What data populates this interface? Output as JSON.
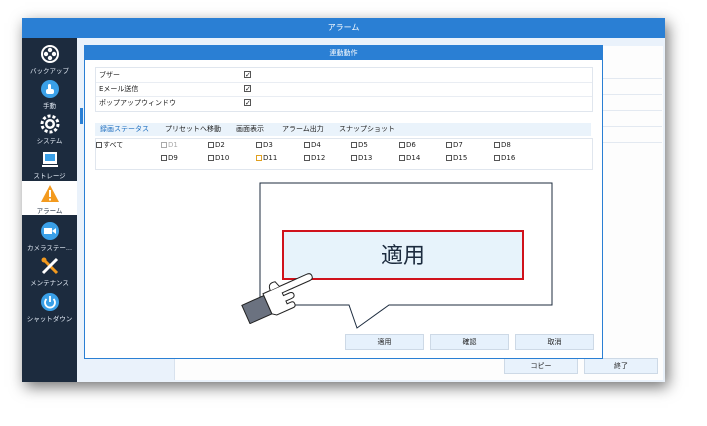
{
  "window": {
    "title": "アラーム"
  },
  "sidebar": {
    "items": [
      {
        "label": "バックアップ",
        "icon": "backup-icon"
      },
      {
        "label": "手動",
        "icon": "manual-record-icon"
      },
      {
        "label": "システム",
        "icon": "gear-icon"
      },
      {
        "label": "ストレージ",
        "icon": "storage-icon"
      },
      {
        "label": "アラーム",
        "icon": "warning-icon",
        "active": true
      },
      {
        "label": "カメラステー...",
        "icon": "camera-icon"
      },
      {
        "label": "メンテナンス",
        "icon": "tools-icon"
      },
      {
        "label": "シャットダウン",
        "icon": "power-icon"
      }
    ]
  },
  "dialog": {
    "title": "連動動作",
    "options": [
      {
        "label": "ブザー",
        "checked": true
      },
      {
        "label": "Eメール送信",
        "checked": true
      },
      {
        "label": "ポップアップウィンドウ",
        "checked": true
      }
    ],
    "tabs": [
      "録画ステータス",
      "プリセットへ移動",
      "画面表示",
      "アラーム出力",
      "スナップショット"
    ],
    "all_label": "すべて",
    "channels_row1": [
      "D1",
      "D2",
      "D3",
      "D4",
      "D5",
      "D6",
      "D7",
      "D8"
    ],
    "channels_row2": [
      "D9",
      "D10",
      "D11",
      "D12",
      "D13",
      "D14",
      "D15",
      "D16"
    ],
    "buttons": {
      "apply": "適用",
      "confirm": "確認",
      "cancel": "取消"
    }
  },
  "zoom": {
    "label": "適用"
  },
  "footer": {
    "copy": "コピー",
    "exit": "終了"
  },
  "colors": {
    "accent": "#2a7fd4",
    "sidebar": "#1c2b3e",
    "highlight": "#d0121b",
    "warning": "#f39a1e"
  }
}
